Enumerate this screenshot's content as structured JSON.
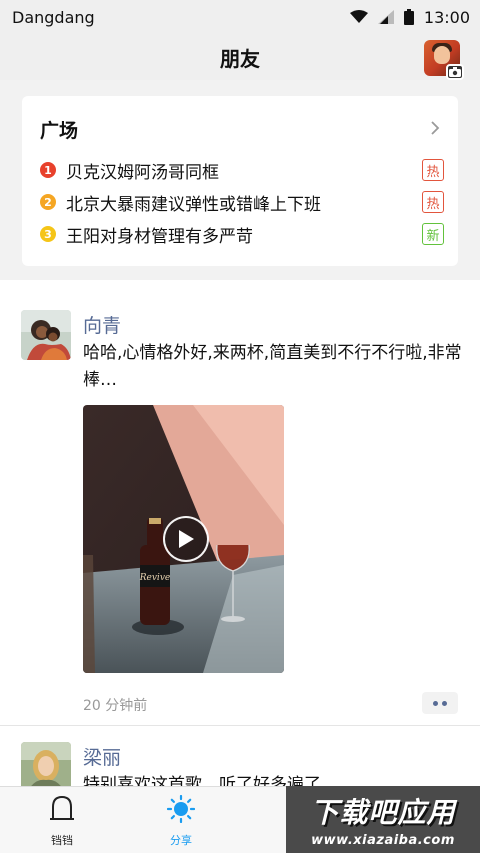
{
  "status_bar": {
    "carrier": "Dangdang",
    "time": "13:00"
  },
  "header": {
    "title": "朋友"
  },
  "square": {
    "title": "广场",
    "items": [
      {
        "rank": "1",
        "rank_color": "#e8412c",
        "text": "贝克汉姆阿汤哥同框",
        "tag": "热",
        "tag_color": "#e2553d"
      },
      {
        "rank": "2",
        "rank_color": "#f5a623",
        "text": "北京大暴雨建议弹性或错峰上下班",
        "tag": "热",
        "tag_color": "#e2553d"
      },
      {
        "rank": "3",
        "rank_color": "#f5c518",
        "text": "王阳对身材管理有多严苛",
        "tag": "新",
        "tag_color": "#62c23c"
      }
    ]
  },
  "posts": [
    {
      "name": "向青",
      "text": "哈哈,心情格外好,来两杯,简直美到不行不行啦,非常棒…",
      "time": "20 分钟前",
      "media": "video",
      "media_label": "Revive"
    },
    {
      "name": "梁丽",
      "text": "特别喜欢这首歌，听了好多遍了"
    }
  ],
  "tabs": [
    {
      "label": "铛铛",
      "icon": "bell-icon"
    },
    {
      "label": "分享",
      "icon": "sun-icon",
      "active": true
    }
  ],
  "watermark": {
    "title": "下载吧应用",
    "url": "www.xiazaiba.com"
  },
  "colors": {
    "link_blue": "#576b95",
    "accent_blue": "#1a9cf0"
  }
}
